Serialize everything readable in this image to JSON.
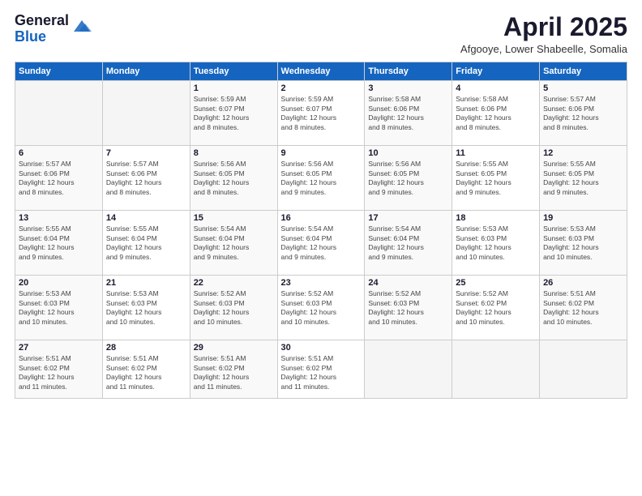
{
  "header": {
    "logo_general": "General",
    "logo_blue": "Blue",
    "month_title": "April 2025",
    "subtitle": "Afgooye, Lower Shabeelle, Somalia"
  },
  "weekdays": [
    "Sunday",
    "Monday",
    "Tuesday",
    "Wednesday",
    "Thursday",
    "Friday",
    "Saturday"
  ],
  "weeks": [
    [
      {
        "day": "",
        "info": ""
      },
      {
        "day": "",
        "info": ""
      },
      {
        "day": "1",
        "info": "Sunrise: 5:59 AM\nSunset: 6:07 PM\nDaylight: 12 hours\nand 8 minutes."
      },
      {
        "day": "2",
        "info": "Sunrise: 5:59 AM\nSunset: 6:07 PM\nDaylight: 12 hours\nand 8 minutes."
      },
      {
        "day": "3",
        "info": "Sunrise: 5:58 AM\nSunset: 6:06 PM\nDaylight: 12 hours\nand 8 minutes."
      },
      {
        "day": "4",
        "info": "Sunrise: 5:58 AM\nSunset: 6:06 PM\nDaylight: 12 hours\nand 8 minutes."
      },
      {
        "day": "5",
        "info": "Sunrise: 5:57 AM\nSunset: 6:06 PM\nDaylight: 12 hours\nand 8 minutes."
      }
    ],
    [
      {
        "day": "6",
        "info": "Sunrise: 5:57 AM\nSunset: 6:06 PM\nDaylight: 12 hours\nand 8 minutes."
      },
      {
        "day": "7",
        "info": "Sunrise: 5:57 AM\nSunset: 6:06 PM\nDaylight: 12 hours\nand 8 minutes."
      },
      {
        "day": "8",
        "info": "Sunrise: 5:56 AM\nSunset: 6:05 PM\nDaylight: 12 hours\nand 8 minutes."
      },
      {
        "day": "9",
        "info": "Sunrise: 5:56 AM\nSunset: 6:05 PM\nDaylight: 12 hours\nand 9 minutes."
      },
      {
        "day": "10",
        "info": "Sunrise: 5:56 AM\nSunset: 6:05 PM\nDaylight: 12 hours\nand 9 minutes."
      },
      {
        "day": "11",
        "info": "Sunrise: 5:55 AM\nSunset: 6:05 PM\nDaylight: 12 hours\nand 9 minutes."
      },
      {
        "day": "12",
        "info": "Sunrise: 5:55 AM\nSunset: 6:05 PM\nDaylight: 12 hours\nand 9 minutes."
      }
    ],
    [
      {
        "day": "13",
        "info": "Sunrise: 5:55 AM\nSunset: 6:04 PM\nDaylight: 12 hours\nand 9 minutes."
      },
      {
        "day": "14",
        "info": "Sunrise: 5:55 AM\nSunset: 6:04 PM\nDaylight: 12 hours\nand 9 minutes."
      },
      {
        "day": "15",
        "info": "Sunrise: 5:54 AM\nSunset: 6:04 PM\nDaylight: 12 hours\nand 9 minutes."
      },
      {
        "day": "16",
        "info": "Sunrise: 5:54 AM\nSunset: 6:04 PM\nDaylight: 12 hours\nand 9 minutes."
      },
      {
        "day": "17",
        "info": "Sunrise: 5:54 AM\nSunset: 6:04 PM\nDaylight: 12 hours\nand 9 minutes."
      },
      {
        "day": "18",
        "info": "Sunrise: 5:53 AM\nSunset: 6:03 PM\nDaylight: 12 hours\nand 10 minutes."
      },
      {
        "day": "19",
        "info": "Sunrise: 5:53 AM\nSunset: 6:03 PM\nDaylight: 12 hours\nand 10 minutes."
      }
    ],
    [
      {
        "day": "20",
        "info": "Sunrise: 5:53 AM\nSunset: 6:03 PM\nDaylight: 12 hours\nand 10 minutes."
      },
      {
        "day": "21",
        "info": "Sunrise: 5:53 AM\nSunset: 6:03 PM\nDaylight: 12 hours\nand 10 minutes."
      },
      {
        "day": "22",
        "info": "Sunrise: 5:52 AM\nSunset: 6:03 PM\nDaylight: 12 hours\nand 10 minutes."
      },
      {
        "day": "23",
        "info": "Sunrise: 5:52 AM\nSunset: 6:03 PM\nDaylight: 12 hours\nand 10 minutes."
      },
      {
        "day": "24",
        "info": "Sunrise: 5:52 AM\nSunset: 6:03 PM\nDaylight: 12 hours\nand 10 minutes."
      },
      {
        "day": "25",
        "info": "Sunrise: 5:52 AM\nSunset: 6:02 PM\nDaylight: 12 hours\nand 10 minutes."
      },
      {
        "day": "26",
        "info": "Sunrise: 5:51 AM\nSunset: 6:02 PM\nDaylight: 12 hours\nand 10 minutes."
      }
    ],
    [
      {
        "day": "27",
        "info": "Sunrise: 5:51 AM\nSunset: 6:02 PM\nDaylight: 12 hours\nand 11 minutes."
      },
      {
        "day": "28",
        "info": "Sunrise: 5:51 AM\nSunset: 6:02 PM\nDaylight: 12 hours\nand 11 minutes."
      },
      {
        "day": "29",
        "info": "Sunrise: 5:51 AM\nSunset: 6:02 PM\nDaylight: 12 hours\nand 11 minutes."
      },
      {
        "day": "30",
        "info": "Sunrise: 5:51 AM\nSunset: 6:02 PM\nDaylight: 12 hours\nand 11 minutes."
      },
      {
        "day": "",
        "info": ""
      },
      {
        "day": "",
        "info": ""
      },
      {
        "day": "",
        "info": ""
      }
    ]
  ]
}
